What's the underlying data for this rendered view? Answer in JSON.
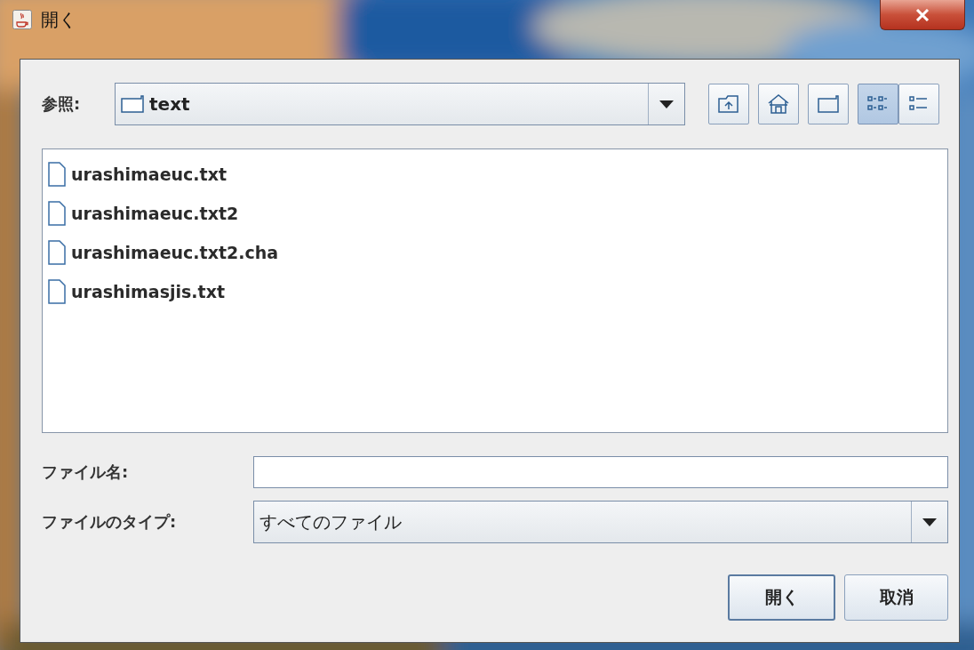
{
  "window": {
    "title": "開く"
  },
  "look_in": {
    "label": "参照:",
    "value": "text"
  },
  "toolbar": [
    {
      "kind": "up",
      "selected": false
    },
    {
      "kind": "home",
      "selected": false
    },
    {
      "kind": "newfolder",
      "selected": false
    },
    {
      "kind": "list",
      "selected": true
    },
    {
      "kind": "details",
      "selected": false
    }
  ],
  "files": [
    {
      "name": "urashimaeuc.txt"
    },
    {
      "name": "urashimaeuc.txt2"
    },
    {
      "name": "urashimaeuc.txt2.cha"
    },
    {
      "name": "urashimasjis.txt"
    }
  ],
  "file_name": {
    "label": "ファイル名:"
  },
  "file_type": {
    "label": "ファイルのタイプ:",
    "value": "すべてのファイル"
  },
  "buttons": [
    {
      "label": "開く",
      "default": true
    },
    {
      "label": "取消",
      "default": false
    }
  ]
}
